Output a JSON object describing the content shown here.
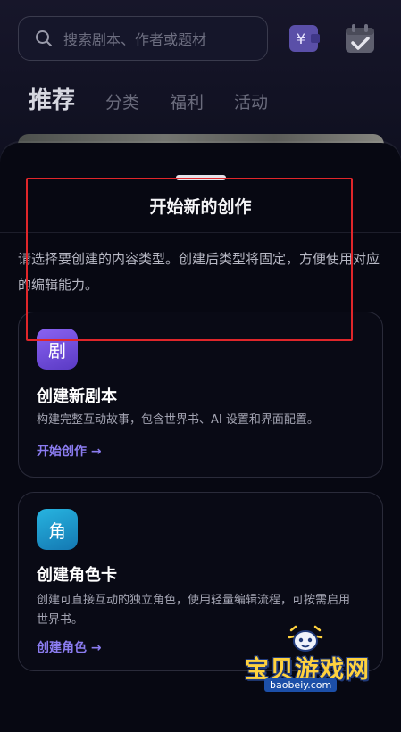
{
  "search": {
    "placeholder": "搜索剧本、作者或题材",
    "icon": "search-icon"
  },
  "top_icons": {
    "wallet": "wallet-yen-icon",
    "calendar": "calendar-check-icon",
    "wallet_symbol": "¥"
  },
  "tabs": [
    {
      "label": "推荐",
      "active": true
    },
    {
      "label": "分类",
      "active": false
    },
    {
      "label": "福利",
      "active": false
    },
    {
      "label": "活动",
      "active": false
    }
  ],
  "sheet": {
    "title": "开始新的创作",
    "description": "请选择要创建的内容类型。创建后类型将固定，方便使用对应的编辑能力。",
    "cards": [
      {
        "badge": "剧",
        "title": "创建新剧本",
        "description": "构建完整互动故事，包含世界书、AI 设置和界面配置。",
        "link": "开始创作 →",
        "badge_color": "#6f4ddc"
      },
      {
        "badge": "角",
        "title": "创建角色卡",
        "description": "创建可直接互动的独立角色，使用轻量编辑流程，可按需启用世界书。",
        "link": "创建角色 →",
        "badge_color": "#1e98cc"
      }
    ]
  },
  "watermark": {
    "text": "宝贝游戏网",
    "url": "baobeiy.com"
  },
  "colors": {
    "accent": "#8b7cf0",
    "highlight": "#e0262a",
    "background": "#070812"
  }
}
